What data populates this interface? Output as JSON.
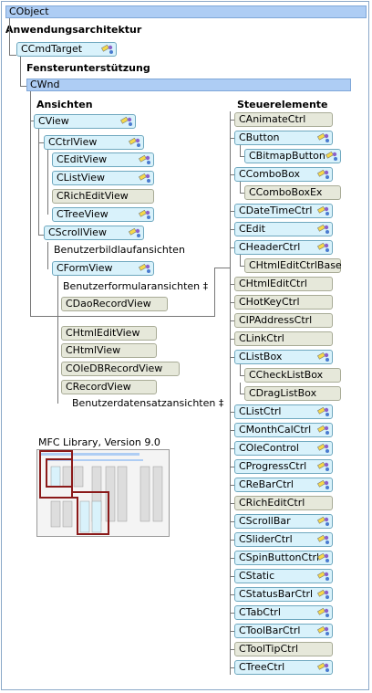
{
  "root": "CObject",
  "groups": {
    "app_arch": "Anwendungsarchitektur",
    "cmdtarget": "CCmdTarget",
    "window_support": "Fensterunterstützung",
    "cwnd": "CWnd",
    "views": "Ansichten",
    "controls": "Steuerelemente"
  },
  "views": {
    "cview": "CView",
    "cctrlview": "CCtrlView",
    "ceditview": "CEditView",
    "clistview": "CListView",
    "crichedit": "CRichEditView",
    "ctreeview": "CTreeView",
    "cscrollview": "CScrollView",
    "scroll_user": "Benutzerbildlaufansichten",
    "cformview": "CFormView",
    "form_user": "Benutzerformularansichten ‡",
    "cdaorecord": "CDaoRecordView",
    "chtmleditview": "CHtmlEditView",
    "chtmlview": "CHtmlView",
    "coledb": "COleDBRecordView",
    "crecordview": "CRecordView",
    "record_user": "Benutzerdatensatzansichten ‡"
  },
  "controls_list": [
    {
      "label": "CAnimateCtrl",
      "kind": "p",
      "badge": false
    },
    {
      "label": "CButton",
      "kind": "k",
      "badge": true
    },
    {
      "label": "CBitmapButton",
      "kind": "k",
      "badge": true,
      "indent": true
    },
    {
      "label": "CComboBox",
      "kind": "k",
      "badge": true
    },
    {
      "label": "CComboBoxEx",
      "kind": "p",
      "badge": false,
      "indent": true
    },
    {
      "label": "CDateTimeCtrl",
      "kind": "k",
      "badge": true
    },
    {
      "label": "CEdit",
      "kind": "k",
      "badge": true
    },
    {
      "label": "CHeaderCtrl",
      "kind": "k",
      "badge": true
    },
    {
      "label": "CHtmlEditCtrlBase",
      "kind": "p",
      "badge": false,
      "indent": true
    },
    {
      "label": "CHtmlEditCtrl",
      "kind": "p",
      "badge": false
    },
    {
      "label": "CHotKeyCtrl",
      "kind": "p",
      "badge": false
    },
    {
      "label": "CIPAddressCtrl",
      "kind": "p",
      "badge": false
    },
    {
      "label": "CLinkCtrl",
      "kind": "p",
      "badge": false
    },
    {
      "label": "CListBox",
      "kind": "k",
      "badge": true
    },
    {
      "label": "CCheckListBox",
      "kind": "p",
      "badge": false,
      "indent": true
    },
    {
      "label": "CDragListBox",
      "kind": "p",
      "badge": false,
      "indent": true
    },
    {
      "label": "CListCtrl",
      "kind": "k",
      "badge": true
    },
    {
      "label": "CMonthCalCtrl",
      "kind": "k",
      "badge": true
    },
    {
      "label": "COleControl",
      "kind": "k",
      "badge": true
    },
    {
      "label": "CProgressCtrl",
      "kind": "k",
      "badge": true
    },
    {
      "label": "CReBarCtrl",
      "kind": "k",
      "badge": true
    },
    {
      "label": "CRichEditCtrl",
      "kind": "p",
      "badge": false
    },
    {
      "label": "CScrollBar",
      "kind": "k",
      "badge": true
    },
    {
      "label": "CSliderCtrl",
      "kind": "k",
      "badge": true
    },
    {
      "label": "CSpinButtonCtrl",
      "kind": "k",
      "badge": true
    },
    {
      "label": "CStatic",
      "kind": "k",
      "badge": true
    },
    {
      "label": "CStatusBarCtrl",
      "kind": "k",
      "badge": true
    },
    {
      "label": "CTabCtrl",
      "kind": "k",
      "badge": true
    },
    {
      "label": "CToolBarCtrl",
      "kind": "k",
      "badge": true
    },
    {
      "label": "CToolTipCtrl",
      "kind": "p",
      "badge": false
    },
    {
      "label": "CTreeCtrl",
      "kind": "k",
      "badge": true
    }
  ],
  "mini_map_title": "MFC Library, Version 9.0",
  "colors": {
    "bar": "#aecdf4",
    "class_node": "#d9f2fb",
    "plain_node": "#e6e8da",
    "highlight": "#8b1a1a"
  }
}
